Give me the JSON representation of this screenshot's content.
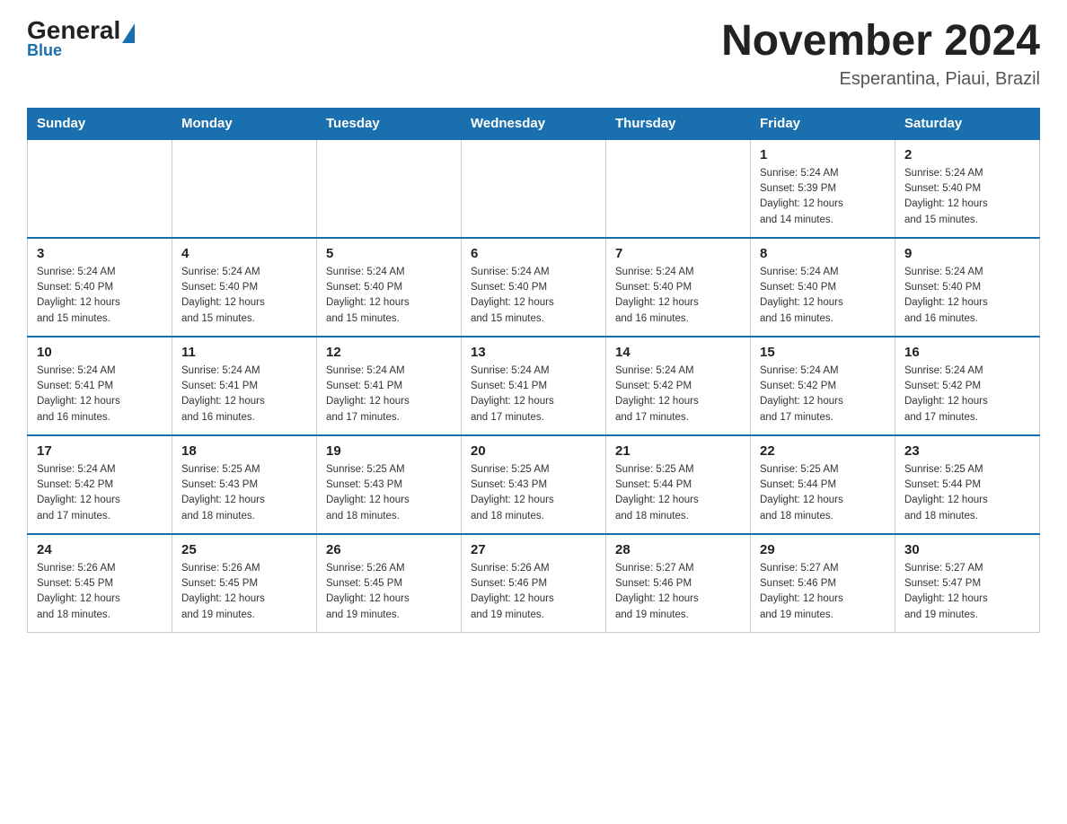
{
  "header": {
    "logo_general": "General",
    "logo_blue": "Blue",
    "month_year": "November 2024",
    "location": "Esperantina, Piaui, Brazil"
  },
  "weekdays": [
    "Sunday",
    "Monday",
    "Tuesday",
    "Wednesday",
    "Thursday",
    "Friday",
    "Saturday"
  ],
  "weeks": [
    [
      {
        "day": "",
        "info": ""
      },
      {
        "day": "",
        "info": ""
      },
      {
        "day": "",
        "info": ""
      },
      {
        "day": "",
        "info": ""
      },
      {
        "day": "",
        "info": ""
      },
      {
        "day": "1",
        "info": "Sunrise: 5:24 AM\nSunset: 5:39 PM\nDaylight: 12 hours\nand 14 minutes."
      },
      {
        "day": "2",
        "info": "Sunrise: 5:24 AM\nSunset: 5:40 PM\nDaylight: 12 hours\nand 15 minutes."
      }
    ],
    [
      {
        "day": "3",
        "info": "Sunrise: 5:24 AM\nSunset: 5:40 PM\nDaylight: 12 hours\nand 15 minutes."
      },
      {
        "day": "4",
        "info": "Sunrise: 5:24 AM\nSunset: 5:40 PM\nDaylight: 12 hours\nand 15 minutes."
      },
      {
        "day": "5",
        "info": "Sunrise: 5:24 AM\nSunset: 5:40 PM\nDaylight: 12 hours\nand 15 minutes."
      },
      {
        "day": "6",
        "info": "Sunrise: 5:24 AM\nSunset: 5:40 PM\nDaylight: 12 hours\nand 15 minutes."
      },
      {
        "day": "7",
        "info": "Sunrise: 5:24 AM\nSunset: 5:40 PM\nDaylight: 12 hours\nand 16 minutes."
      },
      {
        "day": "8",
        "info": "Sunrise: 5:24 AM\nSunset: 5:40 PM\nDaylight: 12 hours\nand 16 minutes."
      },
      {
        "day": "9",
        "info": "Sunrise: 5:24 AM\nSunset: 5:40 PM\nDaylight: 12 hours\nand 16 minutes."
      }
    ],
    [
      {
        "day": "10",
        "info": "Sunrise: 5:24 AM\nSunset: 5:41 PM\nDaylight: 12 hours\nand 16 minutes."
      },
      {
        "day": "11",
        "info": "Sunrise: 5:24 AM\nSunset: 5:41 PM\nDaylight: 12 hours\nand 16 minutes."
      },
      {
        "day": "12",
        "info": "Sunrise: 5:24 AM\nSunset: 5:41 PM\nDaylight: 12 hours\nand 17 minutes."
      },
      {
        "day": "13",
        "info": "Sunrise: 5:24 AM\nSunset: 5:41 PM\nDaylight: 12 hours\nand 17 minutes."
      },
      {
        "day": "14",
        "info": "Sunrise: 5:24 AM\nSunset: 5:42 PM\nDaylight: 12 hours\nand 17 minutes."
      },
      {
        "day": "15",
        "info": "Sunrise: 5:24 AM\nSunset: 5:42 PM\nDaylight: 12 hours\nand 17 minutes."
      },
      {
        "day": "16",
        "info": "Sunrise: 5:24 AM\nSunset: 5:42 PM\nDaylight: 12 hours\nand 17 minutes."
      }
    ],
    [
      {
        "day": "17",
        "info": "Sunrise: 5:24 AM\nSunset: 5:42 PM\nDaylight: 12 hours\nand 17 minutes."
      },
      {
        "day": "18",
        "info": "Sunrise: 5:25 AM\nSunset: 5:43 PM\nDaylight: 12 hours\nand 18 minutes."
      },
      {
        "day": "19",
        "info": "Sunrise: 5:25 AM\nSunset: 5:43 PM\nDaylight: 12 hours\nand 18 minutes."
      },
      {
        "day": "20",
        "info": "Sunrise: 5:25 AM\nSunset: 5:43 PM\nDaylight: 12 hours\nand 18 minutes."
      },
      {
        "day": "21",
        "info": "Sunrise: 5:25 AM\nSunset: 5:44 PM\nDaylight: 12 hours\nand 18 minutes."
      },
      {
        "day": "22",
        "info": "Sunrise: 5:25 AM\nSunset: 5:44 PM\nDaylight: 12 hours\nand 18 minutes."
      },
      {
        "day": "23",
        "info": "Sunrise: 5:25 AM\nSunset: 5:44 PM\nDaylight: 12 hours\nand 18 minutes."
      }
    ],
    [
      {
        "day": "24",
        "info": "Sunrise: 5:26 AM\nSunset: 5:45 PM\nDaylight: 12 hours\nand 18 minutes."
      },
      {
        "day": "25",
        "info": "Sunrise: 5:26 AM\nSunset: 5:45 PM\nDaylight: 12 hours\nand 19 minutes."
      },
      {
        "day": "26",
        "info": "Sunrise: 5:26 AM\nSunset: 5:45 PM\nDaylight: 12 hours\nand 19 minutes."
      },
      {
        "day": "27",
        "info": "Sunrise: 5:26 AM\nSunset: 5:46 PM\nDaylight: 12 hours\nand 19 minutes."
      },
      {
        "day": "28",
        "info": "Sunrise: 5:27 AM\nSunset: 5:46 PM\nDaylight: 12 hours\nand 19 minutes."
      },
      {
        "day": "29",
        "info": "Sunrise: 5:27 AM\nSunset: 5:46 PM\nDaylight: 12 hours\nand 19 minutes."
      },
      {
        "day": "30",
        "info": "Sunrise: 5:27 AM\nSunset: 5:47 PM\nDaylight: 12 hours\nand 19 minutes."
      }
    ]
  ]
}
